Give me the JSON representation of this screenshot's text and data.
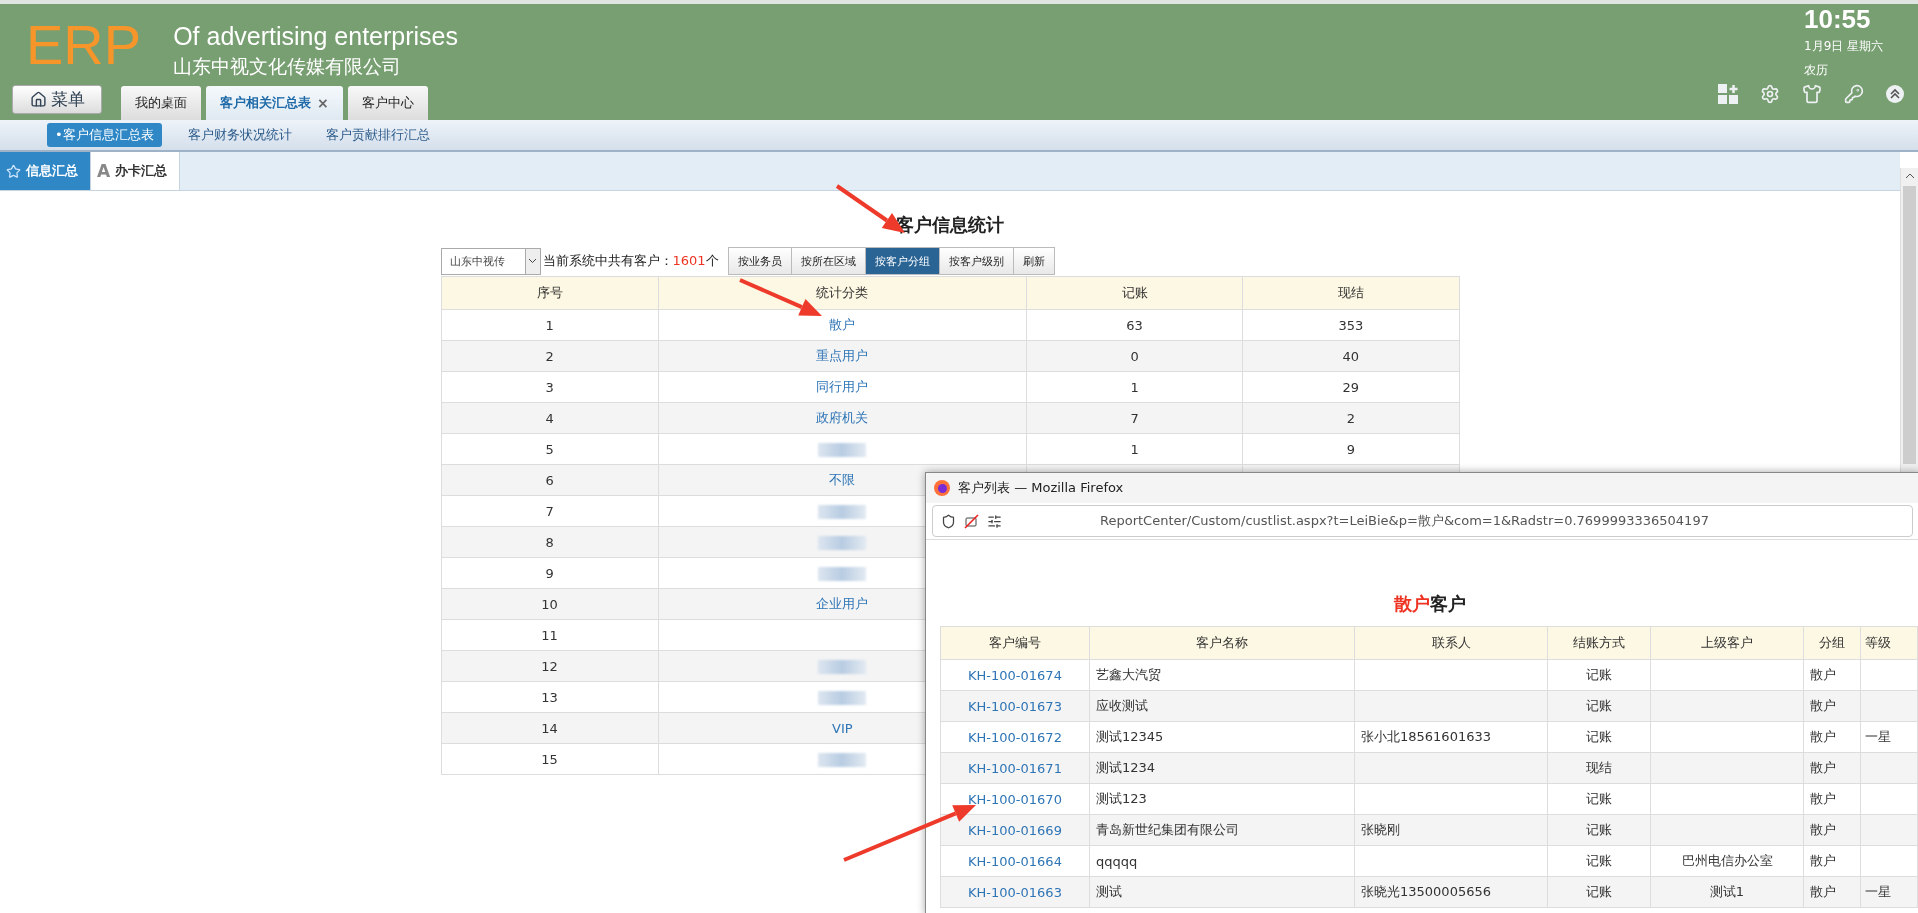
{
  "header": {
    "logo": "ERP",
    "title": "Of advertising enterprises",
    "company": "山东中视文化传媒有限公司",
    "time": "10:55",
    "date": "1月9日 星期六",
    "lunar": "农历"
  },
  "menu_button": "菜单",
  "tabs": [
    {
      "label": "我的桌面",
      "selected": false
    },
    {
      "label": "客户相关汇总表",
      "selected": true,
      "close": "×"
    },
    {
      "label": "客户中心",
      "selected": false
    }
  ],
  "subnav": [
    {
      "label": "•客户信息汇总表",
      "selected": true
    },
    {
      "label": "客户财务状况统计",
      "selected": false
    },
    {
      "label": "客户贡献排行汇总",
      "selected": false
    }
  ],
  "side_tabs": [
    {
      "label": "信息汇总",
      "selected": true,
      "kind": "star"
    },
    {
      "label": "办卡汇总",
      "selected": false,
      "kind": "letter",
      "icon_text": "A"
    }
  ],
  "report": {
    "title": "客户信息统计",
    "company_select": "山东中视传",
    "total_prefix": "当前系统中共有客户：",
    "total": "1601",
    "total_suffix": "个",
    "buttons": [
      {
        "label": "按业务员",
        "selected": false
      },
      {
        "label": "按所在区域",
        "selected": false
      },
      {
        "label": "按客户分组",
        "selected": true
      },
      {
        "label": "按客户级别",
        "selected": false
      },
      {
        "label": "刷新",
        "selected": false
      }
    ],
    "columns": [
      "序号",
      "统计分类",
      "记账",
      "现结"
    ],
    "rows": [
      {
        "index": "1",
        "category": "散户",
        "redacted": false,
        "credit": "63",
        "cash": "353"
      },
      {
        "index": "2",
        "category": "重点用户",
        "redacted": false,
        "credit": "0",
        "cash": "40"
      },
      {
        "index": "3",
        "category": "同行用户",
        "redacted": false,
        "credit": "1",
        "cash": "29"
      },
      {
        "index": "4",
        "category": "政府机关",
        "redacted": false,
        "credit": "7",
        "cash": "2"
      },
      {
        "index": "5",
        "redacted": true,
        "credit": "1",
        "cash": "9"
      },
      {
        "index": "6",
        "category": "不限",
        "redacted": false
      },
      {
        "index": "7",
        "redacted": true
      },
      {
        "index": "8",
        "redacted": true
      },
      {
        "index": "9",
        "redacted": true
      },
      {
        "index": "10",
        "category": "企业用户",
        "redacted": false
      },
      {
        "index": "11",
        "redacted": false
      },
      {
        "index": "12",
        "redacted": true
      },
      {
        "index": "13",
        "redacted": true
      },
      {
        "index": "14",
        "category": "VIP",
        "redacted": false
      },
      {
        "index": "15",
        "redacted": true
      }
    ]
  },
  "popup": {
    "window_title": "客户列表 — Mozilla Firefox",
    "url": "ReportCenter/Custom/custlist.aspx?t=LeiBie&p=散户&com=1&Radstr=0.7699993336504197",
    "heading_highlight": "散户",
    "heading_rest": "客户",
    "columns": [
      "客户编号",
      "客户名称",
      "联系人",
      "结账方式",
      "上级客户",
      "分组",
      "等级"
    ],
    "rows": [
      {
        "id": "KH-100-01674",
        "name": "艺鑫大汽贸",
        "billing": "记账",
        "group": "散户"
      },
      {
        "id": "KH-100-01673",
        "name": "应收测试",
        "billing": "记账",
        "group": "散户"
      },
      {
        "id": "KH-100-01672",
        "name": "测试12345",
        "contact": "张小北18561601633",
        "billing": "记账",
        "group": "散户",
        "level": "一星"
      },
      {
        "id": "KH-100-01671",
        "name": "测试1234",
        "billing": "现结",
        "group": "散户"
      },
      {
        "id": "KH-100-01670",
        "name": "测试123",
        "billing": "记账",
        "group": "散户"
      },
      {
        "id": "KH-100-01669",
        "name": "青岛新世纪集团有限公司",
        "contact": "张晓刚",
        "billing": "记账",
        "group": "散户"
      },
      {
        "id": "KH-100-01664",
        "name": "qqqqq",
        "billing": "记账",
        "parent": "巴州电信办公室",
        "group": "散户"
      },
      {
        "id": "KH-100-01663",
        "name": "测试",
        "contact": "张晓光13500005656",
        "billing": "记账",
        "parent": "测试1",
        "group": "散户",
        "level": "一星"
      }
    ]
  }
}
